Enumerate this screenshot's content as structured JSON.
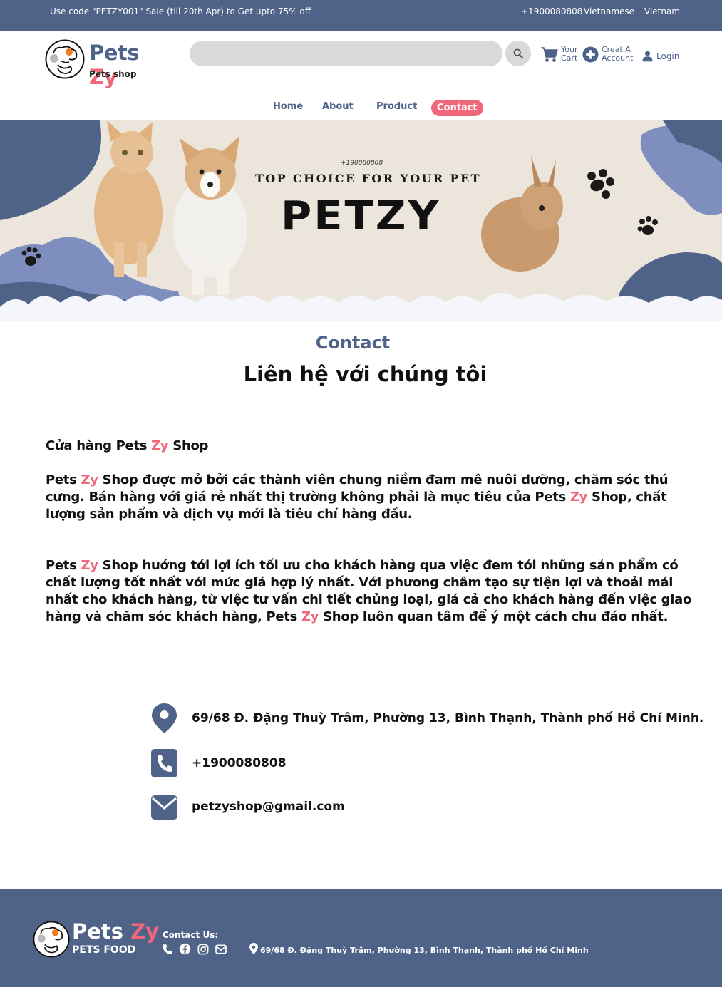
{
  "topbar": {
    "promo": "Use code \"PETZY001\" Sale (till 20th Apr) to Get upto 75% off",
    "phone": "+1900080808",
    "language": "Vietnamese",
    "country": "Vietnam"
  },
  "header": {
    "brand_pets": "Pets",
    "brand_zy": "Zy",
    "brand_sub": "Pets shop",
    "search_placeholder": "",
    "cart_line1": "Your",
    "cart_line2": "Cart",
    "account_line1": "Creat A",
    "account_line2": "Account",
    "login": "Login"
  },
  "nav": {
    "home": "Home",
    "about": "About",
    "product": "Product",
    "contact": "Contact"
  },
  "banner": {
    "phone": "+190080808",
    "tagline": "TOP CHOICE FOR YOUR PET",
    "title": "PETZY"
  },
  "section": {
    "label": "Contact",
    "title": "Liên hệ với chúng tôi"
  },
  "about": {
    "heading_a": "Cửa hàng  Pets ",
    "heading_zy": "Zy",
    "heading_b": " Shop",
    "p1_a": "Pets ",
    "p1_zy": "Zy",
    "p1_b": " Shop được mở bởi các thành viên chung niềm đam mê nuôi dưỡng, chăm sóc thú cưng. Bán hàng với giá rẻ nhất thị trường không phải là mục tiêu của  Pets ",
    "p1_zy2": "Zy",
    "p1_c": " Shop, chất lượng sản phẩm và dịch vụ mới là tiêu chí hàng đầu.",
    "p2_a": " Pets ",
    "p2_zy": "Zy",
    "p2_b": " Shop hướng tới lợi ích tối ưu cho khách hàng qua việc đem tới những sản phẩm có chất lượng tốt nhất với mức giá hợp lý nhất. Với phương châm tạo sự tiện lợi và thoải mái nhất cho khách hàng, từ việc tư vấn chi tiết chủng loại, giá cả cho khách hàng đến việc giao hàng và chăm sóc khách hàng,  Pets ",
    "p2_zy2": "Zy",
    "p2_c": " Shop luôn quan tâm để ý một cách chu đáo nhất."
  },
  "contact": {
    "address": "69/68 Đ. Đặng Thuỳ Trâm, Phường 13, Bình Thạnh, Thành phố Hồ Chí Minh.",
    "phone": "+1900080808",
    "email": "petzyshop@gmail.com"
  },
  "footer": {
    "brand_pets": "Pets",
    "brand_zy": "Zy",
    "sub": "PETS FOOD",
    "contact_label": "Contact Us:",
    "address": "69/68 Đ. Đặng Thuỳ Trâm, Phường 13, Bình Thạnh, Thành phố Hồ Chí Minh"
  },
  "colors": {
    "primary": "#4f6389",
    "accent": "#f0677a",
    "banner_bg": "#ece5dc",
    "search_bg": "#d9d9d9"
  }
}
